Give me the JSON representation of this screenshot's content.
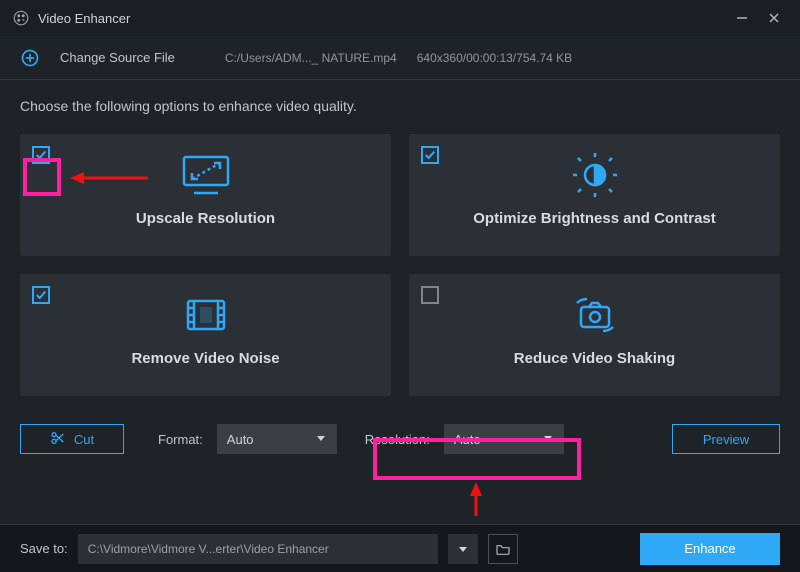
{
  "titlebar": {
    "title": "Video Enhancer"
  },
  "toolbar": {
    "change_source_label": "Change Source File",
    "file_path": "C:/Users/ADM..._ NATURE.mp4",
    "file_meta": "640x360/00:00:13/754.74 KB"
  },
  "instruction": "Choose the following options to enhance video quality.",
  "cards": {
    "upscale": {
      "label": "Upscale Resolution",
      "checked": true
    },
    "brightness": {
      "label": "Optimize Brightness and Contrast",
      "checked": true
    },
    "noise": {
      "label": "Remove Video Noise",
      "checked": true
    },
    "shaking": {
      "label": "Reduce Video Shaking",
      "checked": false
    }
  },
  "controls": {
    "cut_label": "Cut",
    "format_label": "Format:",
    "format_value": "Auto",
    "resolution_label": "Resolution:",
    "resolution_value": "Auto",
    "preview_label": "Preview"
  },
  "footer": {
    "save_to_label": "Save to:",
    "path_value": "C:\\Vidmore\\Vidmore V...erter\\Video Enhancer",
    "enhance_label": "Enhance"
  }
}
